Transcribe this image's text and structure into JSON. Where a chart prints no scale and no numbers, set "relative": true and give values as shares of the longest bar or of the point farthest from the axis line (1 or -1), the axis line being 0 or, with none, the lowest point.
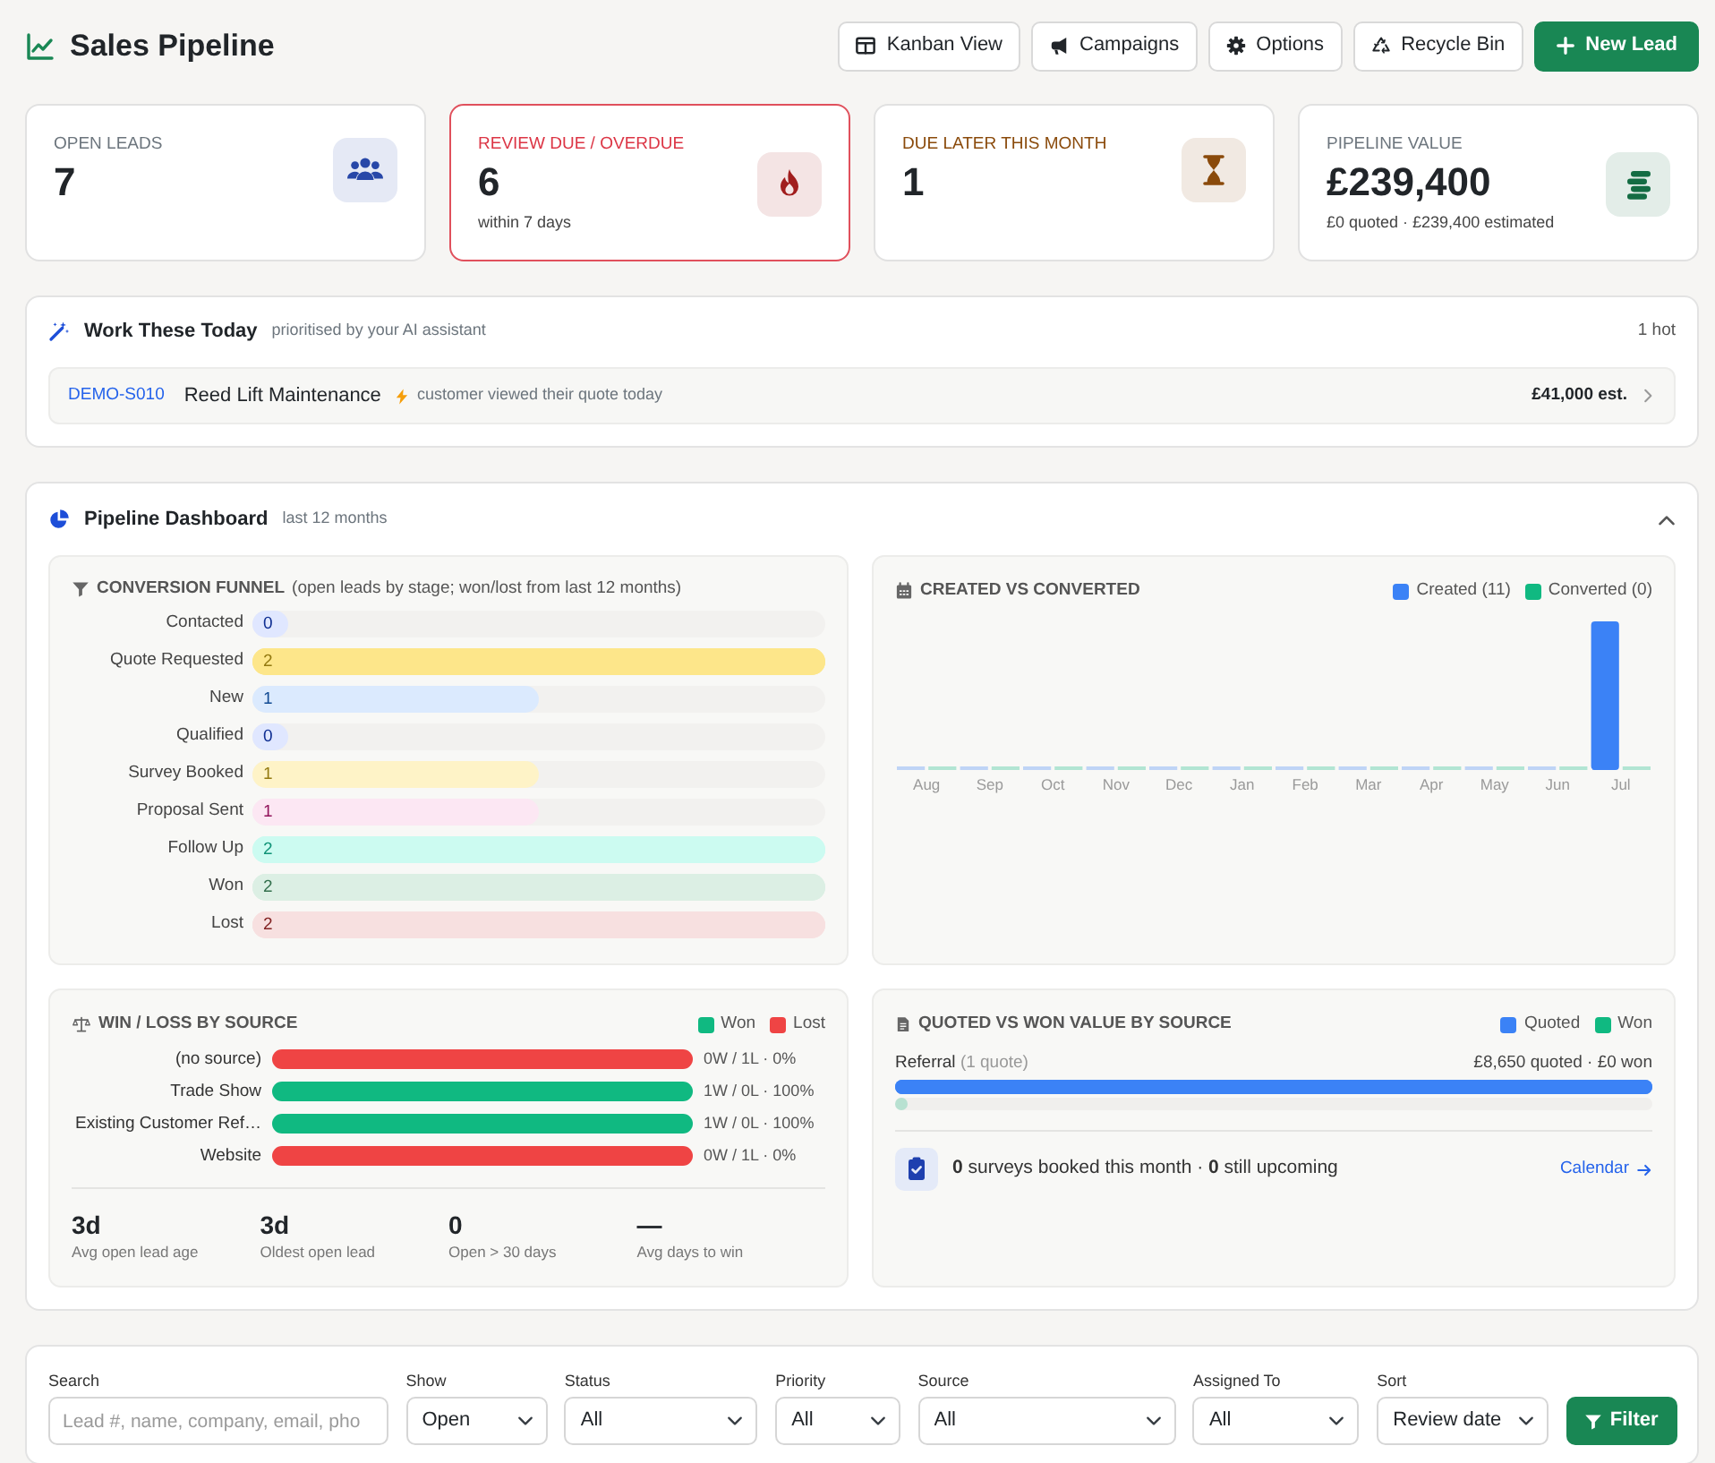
{
  "header": {
    "title": "Sales Pipeline",
    "buttons": [
      {
        "label": "Kanban View",
        "kind": "secondary"
      },
      {
        "label": "Campaigns",
        "kind": "secondary"
      },
      {
        "label": "Options",
        "kind": "secondary"
      },
      {
        "label": "Recycle Bin",
        "kind": "secondary"
      },
      {
        "label": "New Lead",
        "kind": "primary"
      }
    ]
  },
  "stats": [
    {
      "label": "OPEN LEADS",
      "value": "7",
      "kind": "normal",
      "color": "#2747a8"
    },
    {
      "label": "REVIEW DUE / OVERDUE",
      "value": "6",
      "note": "within 7 days",
      "kind": "alert",
      "color": "#a11d1d"
    },
    {
      "label": "DUE LATER THIS MONTH",
      "value": "1",
      "kind": "notice",
      "color": "#8a4a0b"
    },
    {
      "label": "PIPELINE VALUE",
      "value": "£239,400",
      "note": "£0 quoted · £239,400 estimated",
      "kind": "normal",
      "color": "#146c43"
    }
  ],
  "work_today": {
    "title": "Work These Today",
    "subtitle": "prioritised by your AI assistant",
    "count": "1 hot",
    "items": [
      {
        "ref": "DEMO-S010",
        "name": "Reed Lift Maintenance",
        "reason": "customer viewed their quote today",
        "value": "£41,000 est."
      }
    ]
  },
  "dashboard": {
    "title": "Pipeline Dashboard",
    "subtitle": "last 12 months",
    "expanded": true,
    "funnel": {
      "title": "CONVERSION FUNNEL",
      "note": "(open leads by stage; won/lost from last 12 months)",
      "stages": [
        {
          "label": "Contacted",
          "count": "0",
          "level": 0,
          "color": "#e0e7ff"
        },
        {
          "label": "Quote Requested",
          "count": "2",
          "level": 1,
          "color": "#fde68a"
        },
        {
          "label": "New",
          "count": "1",
          "level": 0.5,
          "color": "#dbeafe"
        },
        {
          "label": "Qualified",
          "count": "0",
          "level": 0,
          "color": "#e0e7ff"
        },
        {
          "label": "Survey Booked",
          "count": "1",
          "level": 0.5,
          "color": "#fef3c7"
        },
        {
          "label": "Proposal Sent",
          "count": "1",
          "level": 0.5,
          "color": "#fce7f3"
        },
        {
          "label": "Follow Up",
          "count": "2",
          "level": 1,
          "color": "#ccfbf1"
        },
        {
          "label": "Won",
          "count": "2",
          "level": 1,
          "color": "#dcefe4"
        },
        {
          "label": "Lost",
          "count": "2",
          "level": 1,
          "color": "#f7e0e0"
        }
      ]
    },
    "created_vs_converted": {
      "title": "CREATED VS CONVERTED",
      "chart_data": {
        "type": "bar",
        "relative": true,
        "categories": [
          "Aug",
          "Sep",
          "Oct",
          "Nov",
          "Dec",
          "Jan",
          "Feb",
          "Mar",
          "Apr",
          "May",
          "Jun",
          "Jul"
        ],
        "series": [
          {
            "name": "Created (11)",
            "color": "#3b82f6",
            "values": [
              0,
              0,
              0,
              0,
              0,
              0,
              0,
              0,
              0,
              0,
              0,
              1
            ]
          },
          {
            "name": "Converted (0)",
            "color": "#10b981",
            "values": [
              0,
              0,
              0,
              0,
              0,
              0,
              0,
              0,
              0,
              0,
              0,
              0
            ]
          }
        ]
      }
    },
    "win_loss": {
      "title": "WIN / LOSS BY SOURCE",
      "legend": [
        {
          "label": "Won",
          "color": "#10b981"
        },
        {
          "label": "Lost",
          "color": "#ef4444"
        }
      ],
      "sources": [
        {
          "label": "(no source)",
          "level": 0,
          "result": "0W / 1L · 0%"
        },
        {
          "label": "Trade Show",
          "level": 1,
          "result": "1W / 0L · 100%"
        },
        {
          "label": "Existing Customer Ref…",
          "level": 1,
          "result": "1W / 0L · 100%"
        },
        {
          "label": "Website",
          "level": 0,
          "result": "0W / 1L · 0%"
        }
      ],
      "stats": [
        {
          "value": "3d",
          "label": "Avg open lead age"
        },
        {
          "value": "3d",
          "label": "Oldest open lead"
        },
        {
          "value": "0",
          "label": "Open > 30 days"
        },
        {
          "value": "—",
          "label": "Avg days to win"
        }
      ]
    },
    "quoted_vs_won": {
      "title": "QUOTED VS WON VALUE BY SOURCE",
      "legend": [
        {
          "label": "Quoted",
          "color": "#3b82f6"
        },
        {
          "label": "Won",
          "color": "#10b981"
        }
      ],
      "sources": [
        {
          "label": "Referral",
          "note": "(1 quote)",
          "summary": "£8,650 quoted · £0 won",
          "bars": [
            {
              "level": 1
            },
            {
              "level": 0
            }
          ]
        }
      ],
      "surveys": {
        "text": "**0** surveys booked this month · **0** still upcoming",
        "link": "Calendar"
      }
    }
  },
  "filters": {
    "fields": [
      {
        "label": "Search",
        "kind": "text",
        "placeholder": "Lead #, name, company, email, pho"
      },
      {
        "label": "Show",
        "kind": "select",
        "value": "Open"
      },
      {
        "label": "Status",
        "kind": "select",
        "value": "All"
      },
      {
        "label": "Priority",
        "kind": "select",
        "value": "All"
      },
      {
        "label": "Source",
        "kind": "select",
        "value": "All"
      },
      {
        "label": "Assigned To",
        "kind": "select",
        "value": "All"
      },
      {
        "label": "Sort",
        "kind": "select",
        "value": "Review date"
      }
    ],
    "button": "Filter"
  }
}
